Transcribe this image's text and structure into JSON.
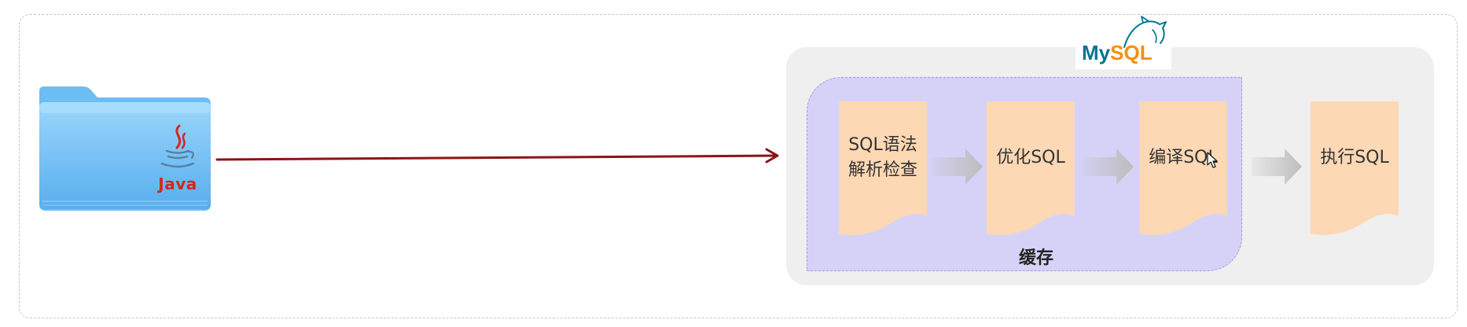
{
  "client": {
    "icon": "java-folder-icon",
    "logo_icon": "java-cup-icon",
    "label": "Java"
  },
  "request_arrow": {
    "icon": "arrow-right-icon"
  },
  "server": {
    "logo_icon": "mysql-dolphin-icon",
    "logo_my": "My",
    "logo_sql": "SQL"
  },
  "cache": {
    "label": "缓存"
  },
  "steps": [
    {
      "lines": [
        "SQL语法",
        "解析检查"
      ]
    },
    {
      "lines": [
        "优化SQL"
      ]
    },
    {
      "lines": [
        "编译SQL"
      ]
    },
    {
      "lines": [
        "执行SQL"
      ]
    }
  ],
  "flow_arrow_icon": "block-arrow-right-icon",
  "cursor_icon": "mouse-pointer-icon",
  "colors": {
    "request_arrow": "#8b1515",
    "cache_fill": "#d6d2f7",
    "cache_border": "#a39dd6",
    "step_fill": "#fcd8b4",
    "server_panel": "#efefef",
    "mysql_teal": "#00758f",
    "mysql_orange": "#f29111",
    "java_red": "#d5261c",
    "java_blue": "#5382a1",
    "folder_blue": "#6cbdf3",
    "outer_border": "#c4c4c4",
    "flow_arrow": "#bdbdbd"
  }
}
